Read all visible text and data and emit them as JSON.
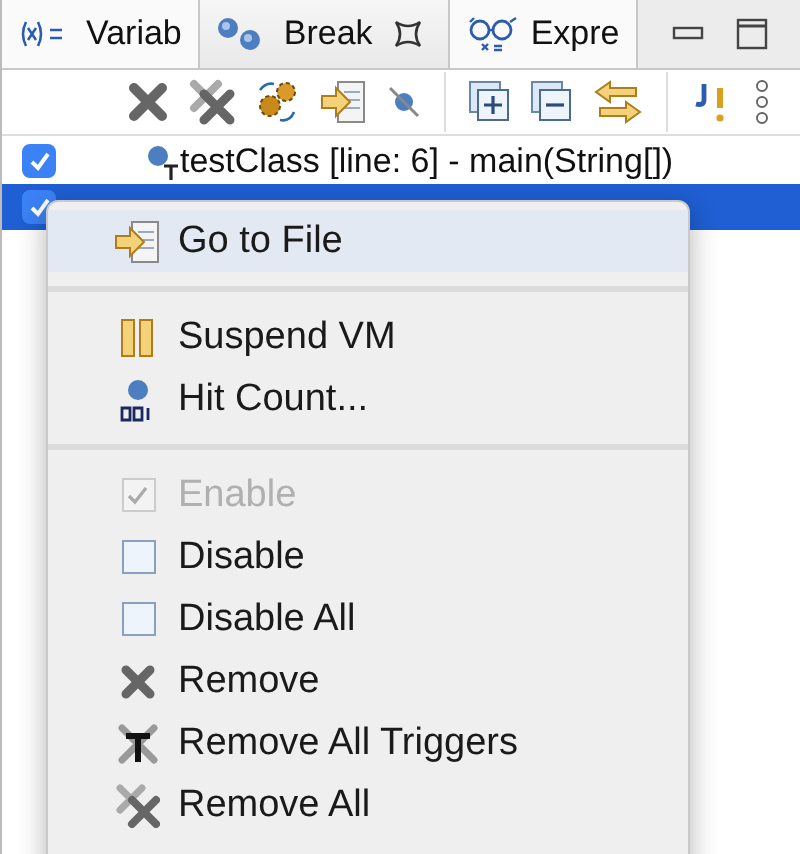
{
  "tabs": [
    {
      "label": "Variab",
      "selected": false
    },
    {
      "label": "Break",
      "selected": true
    },
    {
      "label": "Expre",
      "selected": false
    }
  ],
  "breakpoints": [
    {
      "label": "testClass [line: 6] - main(String[])",
      "checked": true,
      "selected": false
    },
    {
      "checked": true,
      "selected": true
    }
  ],
  "context_menu": [
    [
      {
        "kind": "icon",
        "label": "Go to File",
        "selected": true
      }
    ],
    [
      {
        "kind": "icon",
        "label": "Suspend VM",
        "selected": false
      },
      {
        "kind": "icon",
        "label": "Hit Count...",
        "selected": false
      }
    ],
    [
      {
        "kind": "check",
        "label": "Enable",
        "checked": true,
        "disabled": true,
        "selected": false
      },
      {
        "kind": "check",
        "label": "Disable",
        "checked": false,
        "disabled": false,
        "selected": false
      },
      {
        "kind": "check",
        "label": "Disable All",
        "checked": false,
        "disabled": false,
        "selected": false
      },
      {
        "kind": "icon",
        "label": "Remove",
        "selected": false
      },
      {
        "kind": "icon",
        "label": "Remove All Triggers",
        "selected": false
      },
      {
        "kind": "icon",
        "label": "Remove All",
        "selected": false
      }
    ]
  ]
}
